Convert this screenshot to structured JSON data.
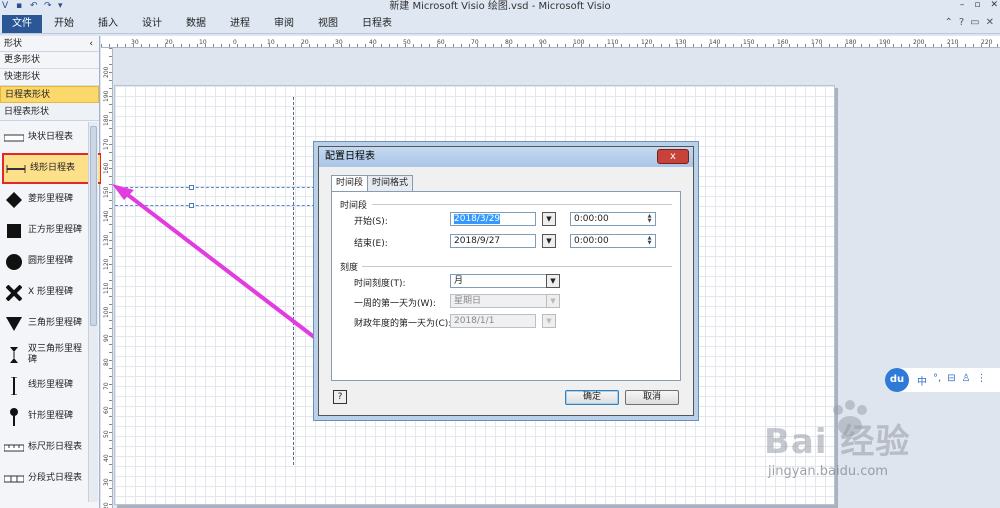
{
  "window": {
    "title": "新建 Microsoft Visio 绘图.vsd  -  Microsoft Visio"
  },
  "ribbon": {
    "file_tab": "文件",
    "tabs": [
      "开始",
      "插入",
      "设计",
      "数据",
      "进程",
      "审阅",
      "视图",
      "日程表"
    ]
  },
  "shapes_pane": {
    "header": "形状",
    "rows": [
      "更多形状",
      "快速形状",
      "日程表形状"
    ],
    "stencil_title": "日程表形状",
    "items": [
      {
        "label": "块状日程表",
        "icon": "block-timeline-icon"
      },
      {
        "label": "线形日程表",
        "icon": "line-timeline-icon"
      },
      {
        "label": "菱形里程碑",
        "icon": "diamond-milestone-icon"
      },
      {
        "label": "正方形里程碑",
        "icon": "square-milestone-icon"
      },
      {
        "label": "圆形里程碑",
        "icon": "circle-milestone-icon"
      },
      {
        "label": "X 形里程碑",
        "icon": "x-milestone-icon"
      },
      {
        "label": "三角形里程碑",
        "icon": "triangle-milestone-icon"
      },
      {
        "label": "双三角形里程碑",
        "icon": "double-triangle-milestone-icon"
      },
      {
        "label": "线形里程碑",
        "icon": "line-milestone-icon"
      },
      {
        "label": "针形里程碑",
        "icon": "pin-milestone-icon"
      },
      {
        "label": "标尺形日程表",
        "icon": "ruler-timeline-icon"
      },
      {
        "label": "分段式日程表",
        "icon": "segmented-timeline-icon"
      }
    ]
  },
  "ruler": {
    "top_ticks": [
      "30",
      "20",
      "10",
      "0",
      "10",
      "20",
      "30",
      "40",
      "50",
      "60",
      "70",
      "80",
      "90",
      "100",
      "110",
      "120",
      "130",
      "140",
      "150",
      "160",
      "170",
      "180",
      "190",
      "200",
      "210",
      "220"
    ],
    "left_ticks": [
      "200",
      "190",
      "180",
      "170",
      "160",
      "150",
      "140",
      "130",
      "120",
      "110",
      "100",
      "90",
      "80",
      "70",
      "60",
      "50",
      "40",
      "30",
      "20"
    ]
  },
  "dialog": {
    "title": "配置日程表",
    "close": "x",
    "tabs": [
      "时间段",
      "时间格式"
    ],
    "period_group": "时间段",
    "start_label": "开始(S):",
    "start_date": "2018/3/29",
    "start_time": "0:00:00",
    "end_label": "结束(E):",
    "end_date": "2018/9/27",
    "end_time": "0:00:00",
    "scale_group": "刻度",
    "scale_label": "时间刻度(T):",
    "scale_value": "月",
    "week_label": "一周的第一天为(W):",
    "week_value": "星期日",
    "fiscal_label": "财政年度的第一天为(C):",
    "fiscal_value": "2018/1/1",
    "help": "?",
    "ok": "确定",
    "cancel": "取消"
  },
  "watermark": {
    "du_logo": "du",
    "du_items": [
      "中",
      "°,",
      "⊟",
      "♙",
      "⋮"
    ],
    "brand": "Bai  经验",
    "url": "jingyan.baidu.com"
  },
  "colors": {
    "annotation_arrow": "#e23be0",
    "highlight_box": "#e2282a",
    "file_tab": "#2b5797"
  }
}
